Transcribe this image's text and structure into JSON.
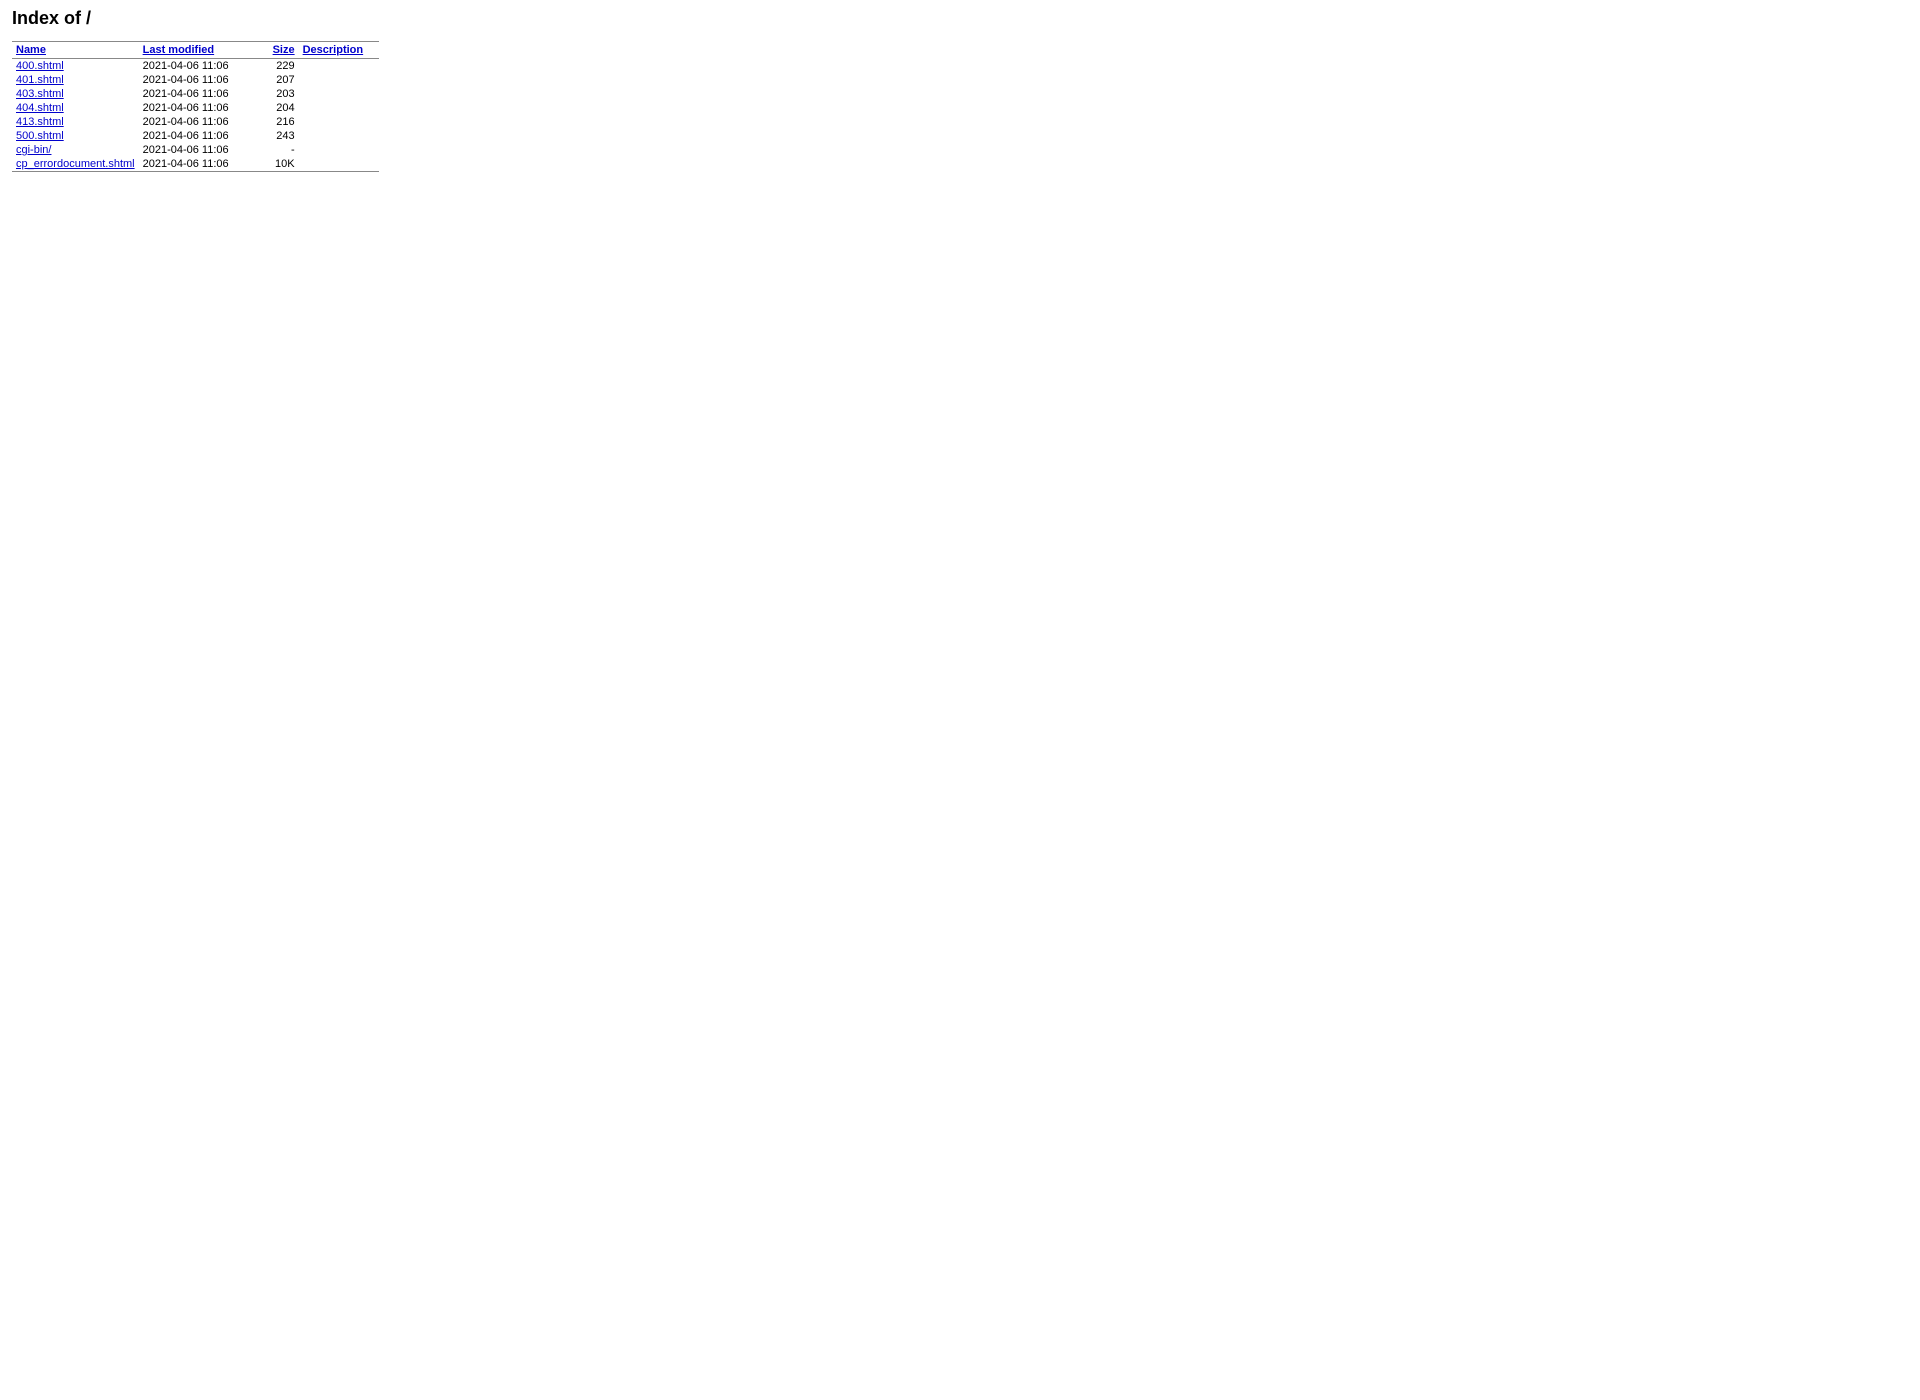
{
  "page": {
    "title": "Index of /"
  },
  "table": {
    "columns": {
      "name": "Name",
      "last_modified": "Last modified",
      "size": "Size",
      "description": "Description"
    },
    "rows": [
      {
        "name": "400.shtml",
        "modified": "2021-04-06 11:06",
        "size": "229",
        "description": ""
      },
      {
        "name": "401.shtml",
        "modified": "2021-04-06 11:06",
        "size": "207",
        "description": ""
      },
      {
        "name": "403.shtml",
        "modified": "2021-04-06 11:06",
        "size": "203",
        "description": ""
      },
      {
        "name": "404.shtml",
        "modified": "2021-04-06 11:06",
        "size": "204",
        "description": ""
      },
      {
        "name": "413.shtml",
        "modified": "2021-04-06 11:06",
        "size": "216",
        "description": ""
      },
      {
        "name": "500.shtml",
        "modified": "2021-04-06 11:06",
        "size": "243",
        "description": ""
      },
      {
        "name": "cgi-bin/",
        "modified": "2021-04-06 11:06",
        "size": "-",
        "description": ""
      },
      {
        "name": "cp_errordocument.shtml",
        "modified": "2021-04-06 11:06",
        "size": "10K",
        "description": ""
      }
    ]
  }
}
